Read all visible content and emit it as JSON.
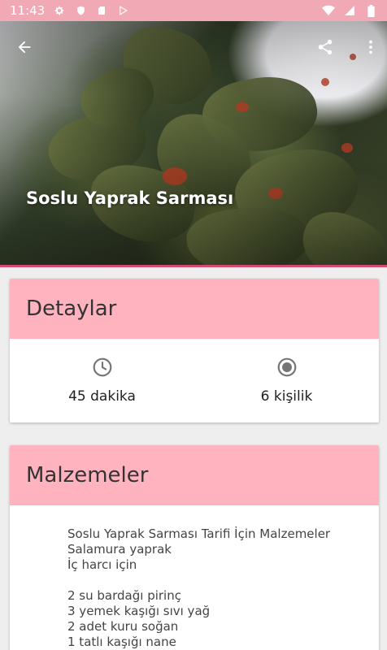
{
  "status_bar": {
    "time": "11:43",
    "left_icons": [
      "gear-icon",
      "shield-icon",
      "sd-card-icon",
      "play-store-icon"
    ],
    "right_icons": [
      "wifi-icon",
      "signal-icon",
      "battery-icon"
    ]
  },
  "hero": {
    "title": "Soslu Yaprak Sarması",
    "icons": [
      "back-arrow-icon",
      "share-icon",
      "more-vert-icon"
    ]
  },
  "details": {
    "heading": "Detaylar",
    "time_value": "45 dakika",
    "time_icon": "clock-icon",
    "servings_value": "6 kişilik",
    "servings_icon": "radio-circle-icon"
  },
  "ingredients": {
    "heading": "Malzemeler",
    "lines": [
      "Soslu Yaprak Sarması Tarifi İçin Malzemeler",
      "Salamura yaprak",
      "İç harcı için",
      "",
      "2 su bardağı pirinç",
      "3 yemek kaşığı sıvı yağ",
      "2 adet kuru soğan",
      "1 tatlı kaşığı nane"
    ]
  },
  "colors": {
    "status_bar": "#f1aab5",
    "card_header": "#ffb3bf",
    "accent_line": "#d34b72"
  }
}
